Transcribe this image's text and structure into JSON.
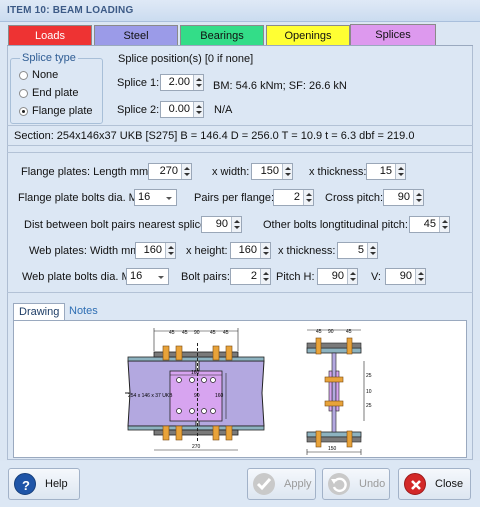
{
  "window": {
    "title": "ITEM 10: BEAM LOADING"
  },
  "tabs": [
    {
      "label": "Loads",
      "color": "#ee3333"
    },
    {
      "label": "Steel",
      "color": "#9b9be8"
    },
    {
      "label": "Bearings",
      "color": "#33dd88"
    },
    {
      "label": "Openings",
      "color": "#ffff33"
    },
    {
      "label": "Splices",
      "color": "#dd99ee"
    }
  ],
  "splice_type": {
    "legend": "Splice type",
    "options": [
      "None",
      "End plate",
      "Flange plate"
    ],
    "selected": "Flange plate"
  },
  "positions": {
    "heading": "Splice position(s) [0 if none]",
    "splice1": {
      "label": "Splice 1:",
      "value": "2.00",
      "result": "BM: 54.6 kNm; SF: 26.6 kN"
    },
    "splice2": {
      "label": "Splice 2:",
      "value": "0.00",
      "result": "N/A"
    }
  },
  "section": "Section: 254x146x37 UKB [S275]  B = 146.4  D = 256.0  T = 10.9  t = 6.3  dbf = 219.0",
  "flange": {
    "length_label": "Flange plates: Length mm:",
    "length": "270",
    "width_label": "x width:",
    "width": "150",
    "thickness_label": "x thickness:",
    "thickness": "15",
    "bolt_label": "Flange plate bolts dia. M",
    "bolt": "16",
    "pairs_label": "Pairs per flange:",
    "pairs": "2",
    "cross_label": "Cross pitch:",
    "cross": "90",
    "dist_label": "Dist between bolt pairs nearest splice:",
    "dist": "90",
    "other_label": "Other bolts longtitudinal pitch:",
    "other": "45"
  },
  "web": {
    "width_label": "Web plates: Width mm:",
    "width": "160",
    "height_label": "x height:",
    "height": "160",
    "thickness_label": "x thickness:",
    "thickness": "5",
    "bolt_label": "Web plate bolts dia. M",
    "bolt": "16",
    "pairs_label": "Bolt pairs:",
    "pairs": "2",
    "pitchh_label": "Pitch H:",
    "pitchh": "90",
    "v_label": "V:",
    "v": "90"
  },
  "bottom_tabs": {
    "drawing": "Drawing",
    "notes": "Notes"
  },
  "drawing_labels": {
    "dim45": "45",
    "dim160": "160",
    "dim90": "90",
    "dim150": "150",
    "dim270": "270",
    "dim25": "25",
    "dim10": "10",
    "section": "254 x 146 x 37 UKB"
  },
  "buttons": {
    "help": "Help",
    "apply": "Apply",
    "undo": "Undo",
    "close": "Close"
  }
}
